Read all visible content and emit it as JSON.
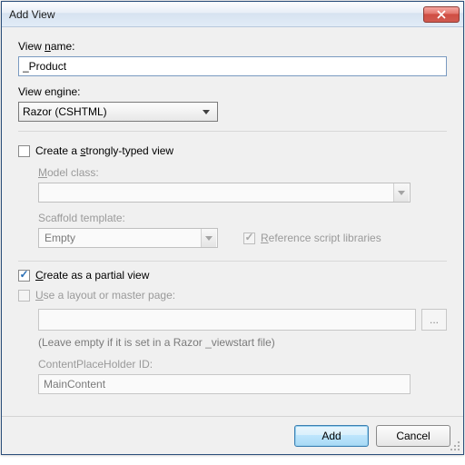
{
  "dialog": {
    "title": "Add View",
    "close_icon": "close-icon"
  },
  "view_name": {
    "label_prefix": "View ",
    "label_underlined": "n",
    "label_suffix": "ame:",
    "value": "_Product"
  },
  "view_engine": {
    "label": "View engine:",
    "selected": "Razor (CSHTML)"
  },
  "strongly_typed": {
    "checked": false,
    "label": "Create a ",
    "label_underlined": "s",
    "label_suffix": "trongly-typed view",
    "model_class": {
      "label_underlined": "M",
      "label_suffix": "odel class:",
      "value": ""
    },
    "scaffold": {
      "label": "Scaffold template:",
      "value": "Empty"
    },
    "ref_scripts": {
      "checked": true,
      "label_underlined": "R",
      "label_suffix": "eference script libraries"
    }
  },
  "partial": {
    "checked": true,
    "label_underlined": "C",
    "label_suffix": "reate as a partial view"
  },
  "layout": {
    "checked": false,
    "label_underlined": "U",
    "label_suffix": "se a layout or master page:",
    "value": "",
    "hint": "(Leave empty if it is set in a Razor _viewstart file)",
    "cph_label": "ContentPlaceHolder ID:",
    "cph_value": "MainContent",
    "browse_label": "..."
  },
  "footer": {
    "add": "Add",
    "cancel": "Cancel"
  }
}
